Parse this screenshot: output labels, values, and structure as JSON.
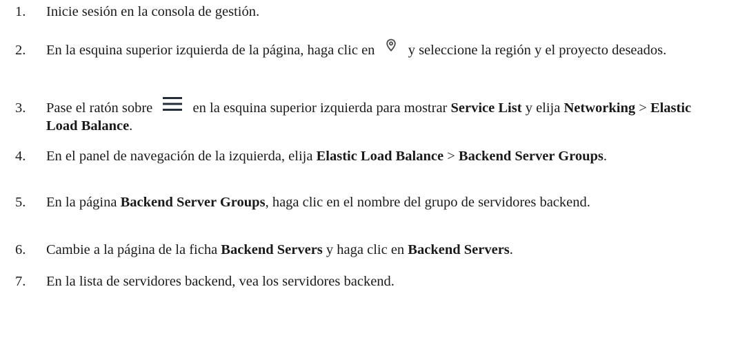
{
  "steps": [
    {
      "num": "1.",
      "parts": [
        {
          "t": "Inicie sesión en la consola de gestión."
        }
      ]
    },
    {
      "num": "2.",
      "parts": [
        {
          "t": "En la esquina superior izquierda de la página, haga clic en "
        },
        {
          "icon": "location-pin-icon"
        },
        {
          "t": " y seleccione la región y el proyecto deseados."
        }
      ]
    },
    {
      "num": "3.",
      "parts": [
        {
          "t": "Pase el ratón sobre "
        },
        {
          "icon": "hamburger-menu-icon"
        },
        {
          "t": " en la esquina superior izquierda para mostrar "
        },
        {
          "b": "Service List"
        },
        {
          "t": " y elija "
        },
        {
          "b": "Networking"
        },
        {
          "t": " > "
        },
        {
          "b": "Elastic Load Balance"
        },
        {
          "t": "."
        }
      ]
    },
    {
      "num": "4.",
      "parts": [
        {
          "t": "En el panel de navegación de la izquierda, elija "
        },
        {
          "b": "Elastic Load Balance"
        },
        {
          "t": " > "
        },
        {
          "b": "Backend Server Groups"
        },
        {
          "t": "."
        }
      ]
    },
    {
      "num": "5.",
      "parts": [
        {
          "t": "En la página "
        },
        {
          "b": "Backend Server Groups"
        },
        {
          "t": ", haga clic en el nombre del grupo de servidores backend."
        }
      ]
    },
    {
      "num": "6.",
      "parts": [
        {
          "t": "Cambie a la página de la ficha "
        },
        {
          "b": "Backend Servers"
        },
        {
          "t": " y haga clic en "
        },
        {
          "b": "Backend Servers"
        },
        {
          "t": "."
        }
      ]
    },
    {
      "num": "7.",
      "parts": [
        {
          "t": "En la lista de servidores backend, vea los servidores backend."
        }
      ]
    }
  ],
  "colors": {
    "text": "#1a1a1a",
    "pin_icon": "#4a4a4a",
    "menu_icon": "#1f2d3d"
  }
}
